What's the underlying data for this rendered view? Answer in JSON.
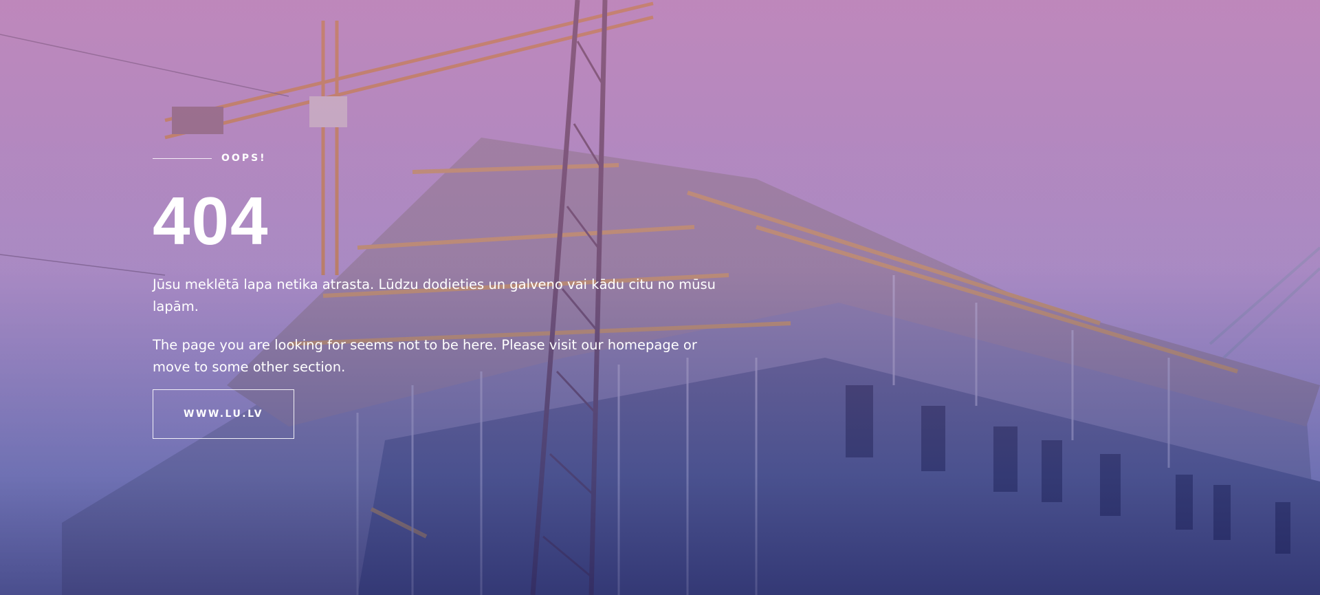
{
  "hero": {
    "eyebrow": "OOPS!",
    "code": "404",
    "message_lv": "Jūsu meklētā lapa netika atrasta. Lūdzu dodieties un galveno vai kādu citu no mūsu lapām.",
    "message_en": "The page you are looking for seems not to be here. Please visit our homepage or move to some other section.",
    "cta_label": "WWW.LU.LV"
  },
  "colors": {
    "overlay_top": "#b27aa9",
    "overlay_bottom": "#2a2c6e",
    "text": "#ffffff"
  }
}
